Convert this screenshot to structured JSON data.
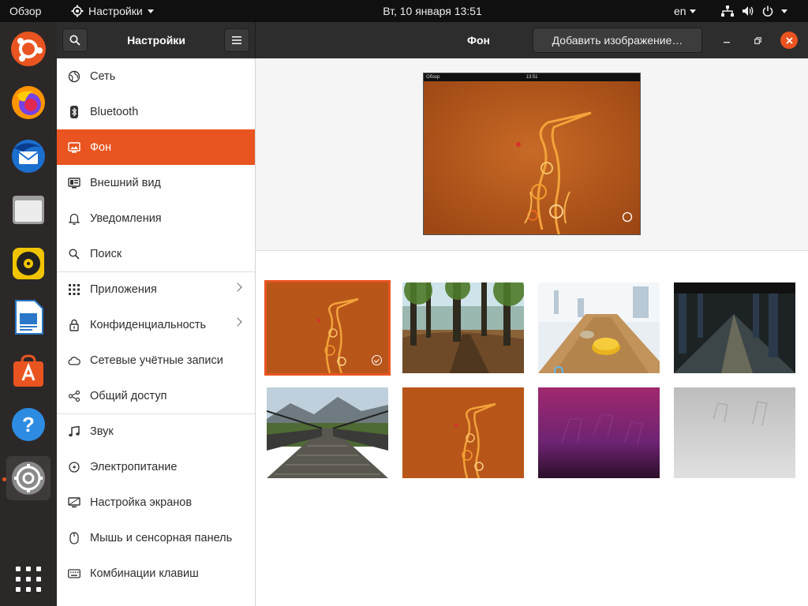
{
  "topbar": {
    "activities": "Обзор",
    "app_name": "Настройки",
    "clock": "Вт, 10 января  13:51",
    "language": "en"
  },
  "dock": {
    "items": [
      "ubuntu-logo-icon",
      "firefox-icon",
      "thunderbird-icon",
      "files-icon",
      "rhythmbox-icon",
      "libreoffice-writer-icon",
      "software-center-icon",
      "help-icon",
      "settings-icon",
      "show-applications-icon"
    ]
  },
  "header": {
    "sidebar_title": "Настройки",
    "page_title": "Фон",
    "add_image_label": "Добавить изображение…"
  },
  "sidebar": {
    "items": [
      {
        "label": "Сеть",
        "icon": "network-icon"
      },
      {
        "label": "Bluetooth",
        "icon": "bluetooth-icon"
      },
      {
        "label": "Фон",
        "icon": "background-icon",
        "selected": true
      },
      {
        "label": "Внешний вид",
        "icon": "appearance-icon"
      },
      {
        "label": "Уведомления",
        "icon": "bell-icon"
      },
      {
        "label": "Поиск",
        "icon": "search-icon"
      },
      {
        "label": "Приложения",
        "icon": "apps-grid-icon",
        "submenu": true
      },
      {
        "label": "Конфиденциальность",
        "icon": "lock-icon",
        "submenu": true
      },
      {
        "label": "Сетевые учётные записи",
        "icon": "cloud-icon"
      },
      {
        "label": "Общий доступ",
        "icon": "share-icon"
      },
      {
        "label": "Звук",
        "icon": "music-note-icon"
      },
      {
        "label": "Электропитание",
        "icon": "power-icon"
      },
      {
        "label": "Настройка экранов",
        "icon": "display-icon"
      },
      {
        "label": "Мышь и сенсорная панель",
        "icon": "mouse-icon"
      },
      {
        "label": "Комбинации клавиш",
        "icon": "keyboard-icon"
      }
    ]
  },
  "preview": {
    "bar_left": "Обзор",
    "bar_time": "13:51"
  },
  "wallpapers": [
    {
      "name": "focal-fossa-orange",
      "selected": true
    },
    {
      "name": "forest-trees"
    },
    {
      "name": "table-lamp"
    },
    {
      "name": "subway-platform"
    },
    {
      "name": "suspension-bridge"
    },
    {
      "name": "focal-fossa-orange-2"
    },
    {
      "name": "purple-gradient"
    },
    {
      "name": "grey-chairs"
    }
  ],
  "colors": {
    "accent": "#e95420",
    "topbar": "#101010",
    "dock": "#2c2828",
    "headerbar": "#2d2d2d"
  }
}
